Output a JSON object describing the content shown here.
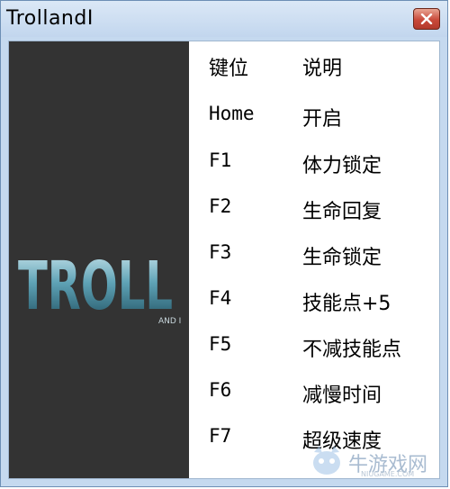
{
  "window": {
    "title": "TrollandI"
  },
  "logo": {
    "text": "TROLL",
    "sub": "AND I"
  },
  "table": {
    "header": {
      "key": "键位",
      "desc": "说明"
    },
    "rows": [
      {
        "key": "Home",
        "desc": "开启"
      },
      {
        "key": "F1",
        "desc": "体力锁定"
      },
      {
        "key": "F2",
        "desc": "生命回复"
      },
      {
        "key": "F3",
        "desc": "生命锁定"
      },
      {
        "key": "F4",
        "desc": "技能点+5"
      },
      {
        "key": "F5",
        "desc": "不减技能点"
      },
      {
        "key": "F6",
        "desc": "减慢时间"
      },
      {
        "key": "F7",
        "desc": "超级速度"
      }
    ]
  },
  "watermark": {
    "text": "牛游戏网",
    "sub": "NIUGAME.COM"
  },
  "colors": {
    "logo_panel": "#333333",
    "close_button": "#c9493a",
    "title_bar": "#c2d6ee"
  }
}
